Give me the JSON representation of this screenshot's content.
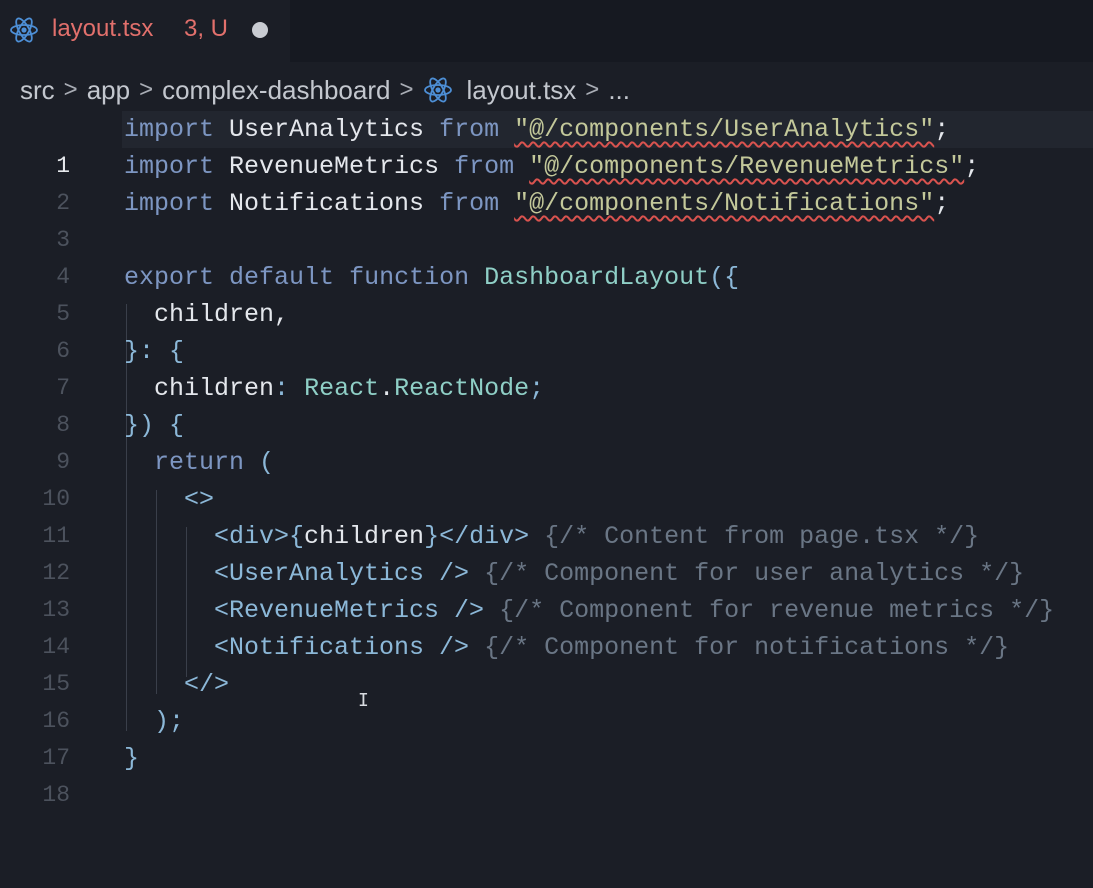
{
  "tab": {
    "filename": "layout.tsx",
    "status": "3, U",
    "icon": "react-icon"
  },
  "breadcrumb": {
    "items": [
      "src",
      "app",
      "complex-dashboard",
      "layout.tsx",
      "..."
    ],
    "separator": ">"
  },
  "editor": {
    "active_line": 1,
    "line_numbers": [
      "1",
      "2",
      "3",
      "4",
      "5",
      "6",
      "7",
      "8",
      "9",
      "10",
      "11",
      "12",
      "13",
      "14",
      "15",
      "16",
      "17",
      "18"
    ],
    "code": {
      "l1": {
        "kw": "import",
        "id": "UserAnalytics",
        "from": "from",
        "str": "\"@/components/UserAnalytics\"",
        "end": ";"
      },
      "l2": {
        "kw": "import",
        "id": "RevenueMetrics",
        "from": "from",
        "str": "\"@/components/RevenueMetrics\"",
        "end": ";"
      },
      "l3": {
        "kw": "import",
        "id": "Notifications",
        "from": "from",
        "str": "\"@/components/Notifications\"",
        "end": ";"
      },
      "l5": {
        "kw1": "export",
        "kw2": "default",
        "kw3": "function",
        "fn": "DashboardLayout",
        "open": "({"
      },
      "l6": {
        "id": "children",
        "end": ","
      },
      "l7": {
        "text": "}: {"
      },
      "l8": {
        "id": "children",
        "colon": ":",
        "ns": "React",
        "dot": ".",
        "ty": "ReactNode",
        "end": ";"
      },
      "l9": {
        "text": "}) {"
      },
      "l10": {
        "kw": "return",
        "open": "("
      },
      "l11": {
        "text": "<>"
      },
      "l12": {
        "open": "<div>{",
        "id": "children",
        "close": "}</div>",
        "cm": "{/* Content from page.tsx */}"
      },
      "l13": {
        "tag": "<UserAnalytics />",
        "cm": "{/* Component for user analytics */}"
      },
      "l14": {
        "tag": "<RevenueMetrics />",
        "cm": "{/* Component for revenue metrics */}"
      },
      "l15": {
        "tag": "<Notifications />",
        "cm": "{/* Component for notifications */}"
      },
      "l16": {
        "text": "</>"
      },
      "l17": {
        "text": ");"
      },
      "l18": {
        "text": "}"
      }
    }
  },
  "colors": {
    "background": "#1b1e26",
    "tab_text": "#e2706c",
    "keyword": "#7d96c2",
    "string": "#c3c89a",
    "type": "#8fcfc6",
    "comment": "#6a7685",
    "error_squiggle": "#d9534f"
  }
}
